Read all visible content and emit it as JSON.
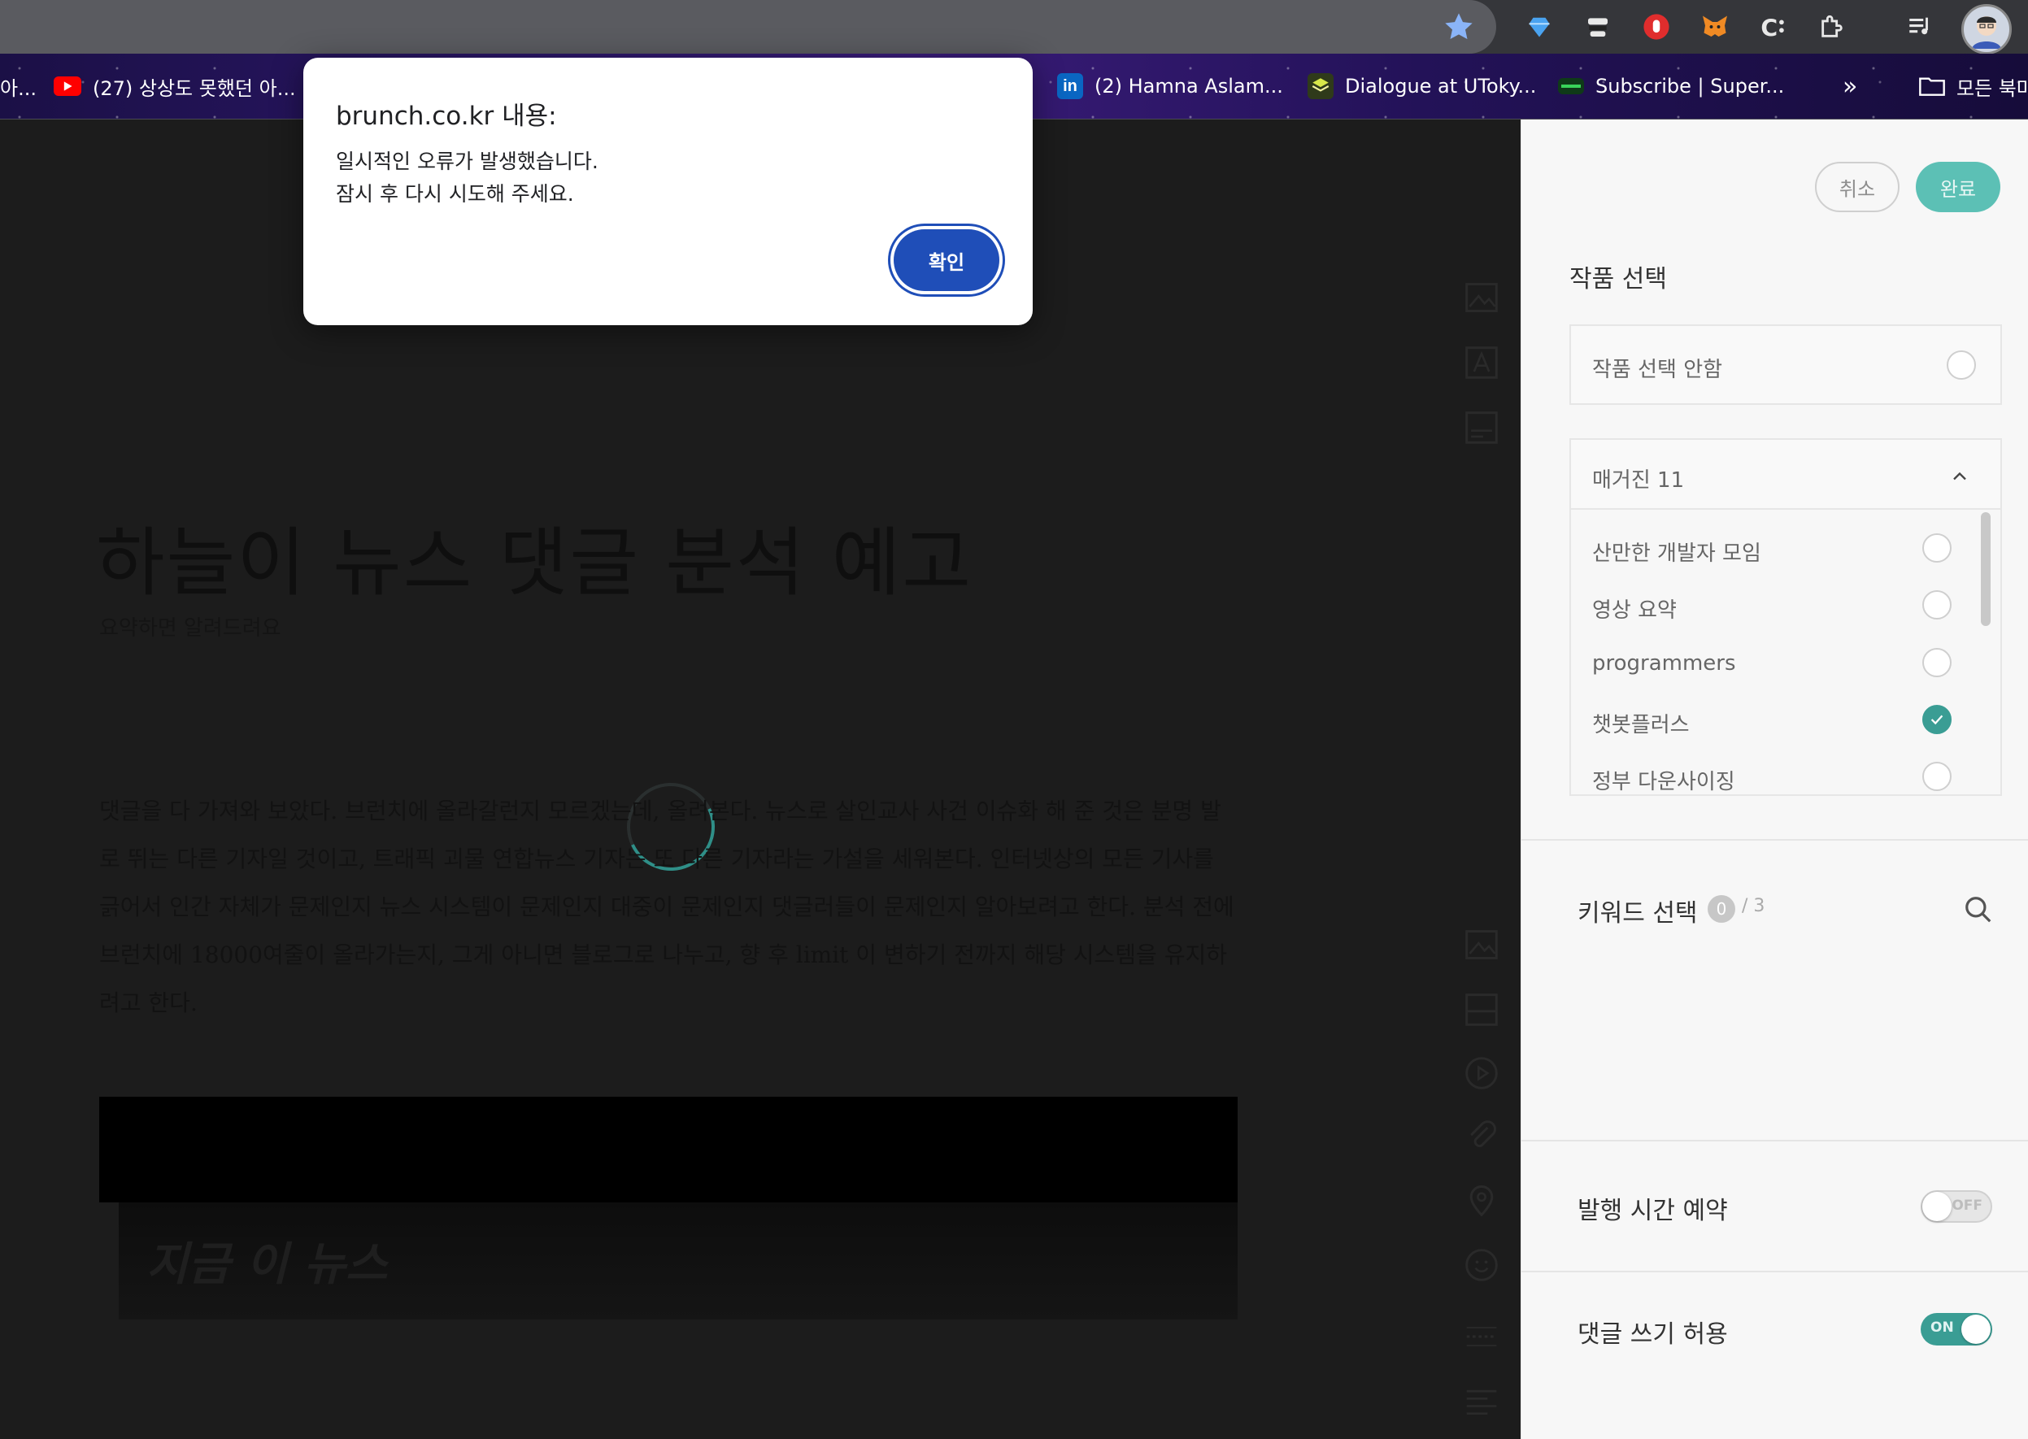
{
  "browser": {
    "bookmarks": [
      {
        "label": "아...",
        "icon": "bookmark-icon"
      },
      {
        "label": "(27) 상상도 못했던 아...",
        "icon": "youtube-icon"
      },
      {
        "label": "(2) Hamna Aslam...",
        "icon": "linkedin-icon"
      },
      {
        "label": "Dialogue at UToky...",
        "icon": "stack-icon"
      },
      {
        "label": "Subscribe | Super...",
        "icon": "subscribe-icon"
      },
      {
        "label": "모든 북마",
        "icon": "folder-icon"
      }
    ],
    "overflow_label": "»"
  },
  "dialog": {
    "title": "brunch.co.kr 내용:",
    "message": "일시적인 오류가 발생했습니다.\n잠시 후 다시 시도해 주세요.",
    "ok_label": "확인"
  },
  "editor": {
    "title": "하늘이 뉴스 댓글 분석 예고",
    "subtitle": "요약하면 알려드려요",
    "body": "댓글을 다 가져와 보았다. 브런치에 올라갈런지 모르겠는데, 올려본다. 뉴스로 살인교사 사건 이슈화 해 준 것은 분명 발로 뛰는 다른 기자일 것이고, 트래픽 괴물 연합뉴스 기자는 또 다른 기자라는 가설을 세워본다. 인터넷상의 모든 기사를 긁어서 인간 자체가 문제인지 뉴스 시스템이 문제인지 대중이 문제인지 댓글러들이 문제인지 알아보려고 한다. 분석 전에 브런치에 18000여줄이 올라가는지, 그게 아니면 블로그로 나누고, 향 후 limit 이 변하기 전까지 해당 시스템을 유지하려고 한다.",
    "thumb_text": "지금 이 뉴스"
  },
  "panel": {
    "cancel_label": "취소",
    "done_label": "완료",
    "section_title": "작품 선택",
    "no_select_label": "작품 선택 안함",
    "magazine_header": "매거진 11",
    "magazines": [
      {
        "name": "산만한 개발자 모임",
        "checked": false
      },
      {
        "name": "영상 요약",
        "checked": false
      },
      {
        "name": "programmers",
        "checked": false
      },
      {
        "name": "챗봇플러스",
        "checked": true
      },
      {
        "name": "정부 다운사이징",
        "checked": false
      }
    ],
    "keyword_label": "키워드 선택",
    "keyword_count": "0",
    "keyword_total": "/ 3",
    "schedule_label": "발행 시간 예약",
    "schedule_state": "OFF",
    "comments_label": "댓글 쓰기 허용",
    "comments_state": "ON"
  },
  "colors": {
    "accent": "#3a9d94",
    "dialog_button": "#1f4eb8",
    "done_button": "#5cc0b5"
  }
}
